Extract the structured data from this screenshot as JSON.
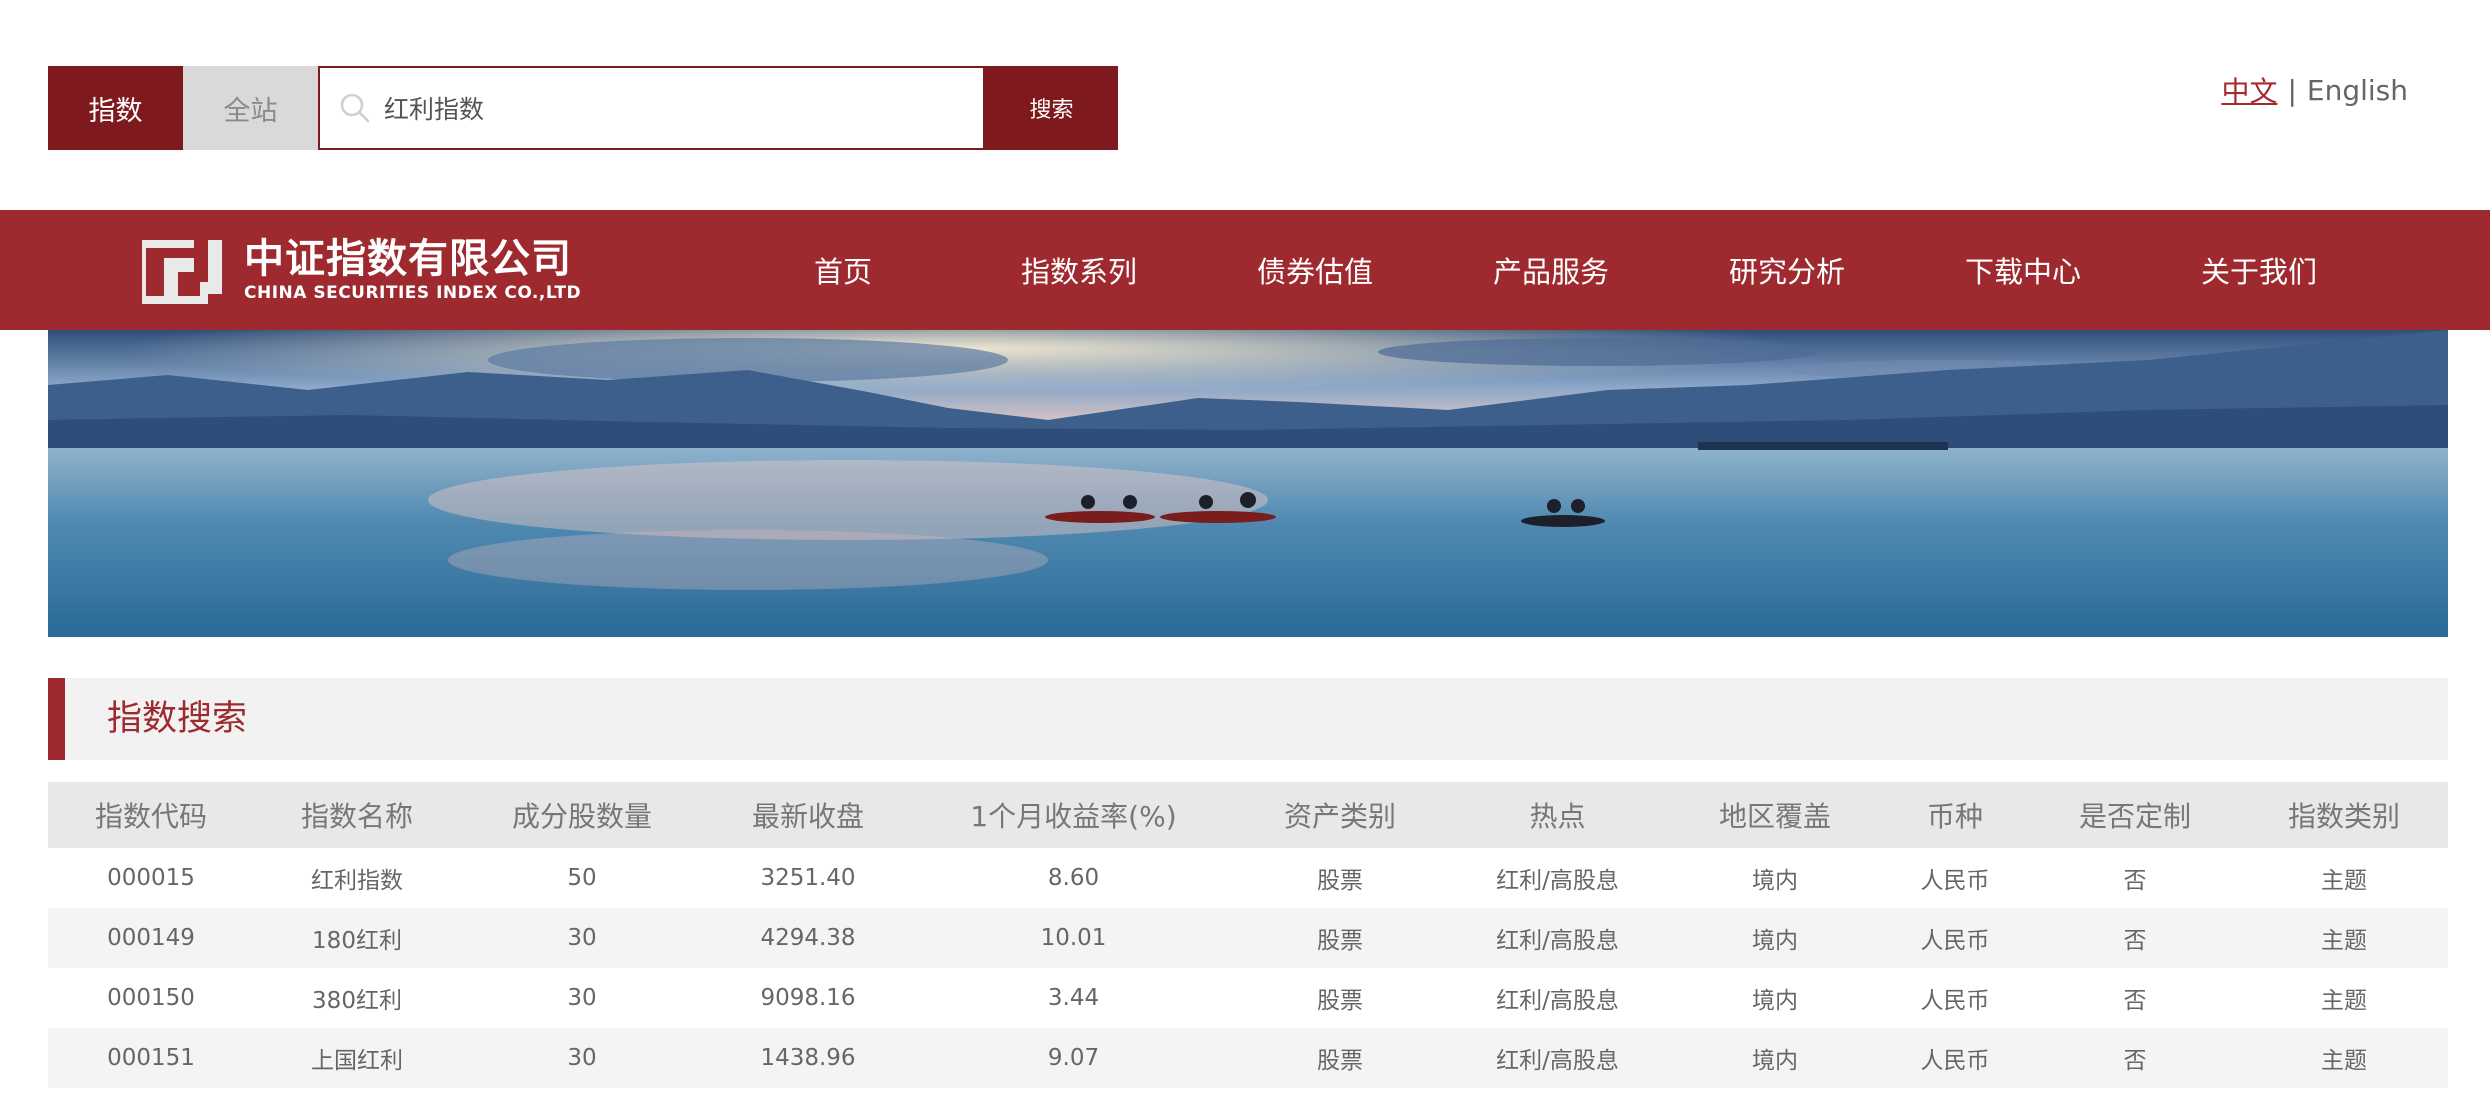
{
  "search": {
    "scope_active": "指数",
    "scope_other": "全站",
    "value": "红利指数",
    "button": "搜索"
  },
  "lang": {
    "zh": "中文",
    "separator": "|",
    "en": "English"
  },
  "nav": {
    "logo_cn": "中证指数有限公司",
    "logo_en": "CHINA SECURITIES INDEX CO.,LTD",
    "items": [
      "首页",
      "指数系列",
      "债券估值",
      "产品服务",
      "研究分析",
      "下载中心",
      "关于我们"
    ]
  },
  "section": {
    "title": "指数搜索"
  },
  "table": {
    "headers": [
      "指数代码",
      "指数名称",
      "成分股数量",
      "最新收盘",
      "1个月收益率(%)",
      "资产类别",
      "热点",
      "地区覆盖",
      "币种",
      "是否定制",
      "指数类别"
    ],
    "rows": [
      [
        "000015",
        "红利指数",
        "50",
        "3251.40",
        "8.60",
        "股票",
        "红利/高股息",
        "境内",
        "人民币",
        "否",
        "主题"
      ],
      [
        "000149",
        "180红利",
        "30",
        "4294.38",
        "10.01",
        "股票",
        "红利/高股息",
        "境内",
        "人民币",
        "否",
        "主题"
      ],
      [
        "000150",
        "380红利",
        "30",
        "9098.16",
        "3.44",
        "股票",
        "红利/高股息",
        "境内",
        "人民币",
        "否",
        "主题"
      ],
      [
        "000151",
        "上国红利",
        "30",
        "1438.96",
        "9.07",
        "股票",
        "红利/高股息",
        "境内",
        "人民币",
        "否",
        "主题"
      ]
    ]
  },
  "colors": {
    "brand_red": "#9e2a2f",
    "dark_red": "#7e1a1d"
  }
}
